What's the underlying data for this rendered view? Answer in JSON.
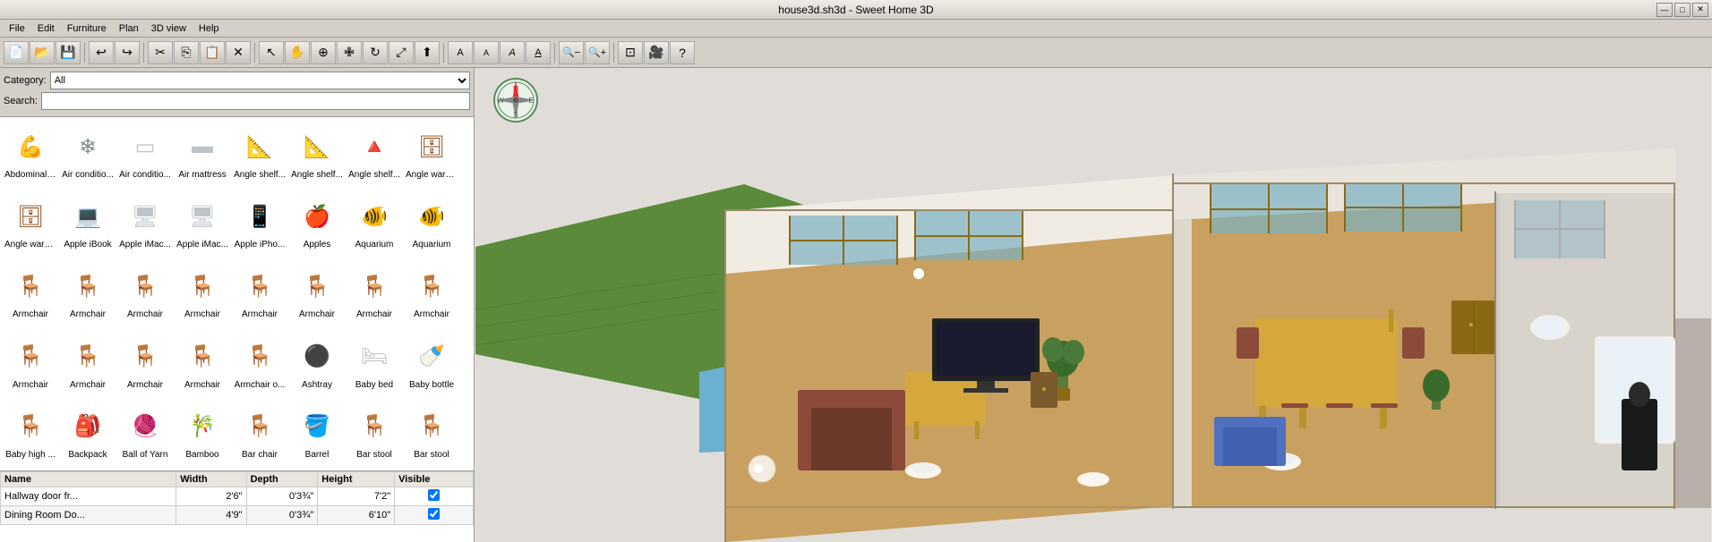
{
  "titlebar": {
    "title": "house3d.sh3d - Sweet Home 3D",
    "min_label": "—",
    "max_label": "□",
    "close_label": "✕"
  },
  "menu": {
    "items": [
      "File",
      "Edit",
      "Furniture",
      "Plan",
      "3D view",
      "Help"
    ]
  },
  "toolbar": {
    "buttons": [
      {
        "name": "new",
        "icon": "📄"
      },
      {
        "name": "open",
        "icon": "📂"
      },
      {
        "name": "save",
        "icon": "💾"
      },
      {
        "name": "sep1",
        "icon": ""
      },
      {
        "name": "undo",
        "icon": "↩"
      },
      {
        "name": "redo",
        "icon": "↪"
      },
      {
        "name": "sep2",
        "icon": ""
      },
      {
        "name": "cut",
        "icon": "✂"
      },
      {
        "name": "copy",
        "icon": "⎘"
      },
      {
        "name": "paste",
        "icon": "📋"
      },
      {
        "name": "delete",
        "icon": "🗑"
      },
      {
        "name": "sep3",
        "icon": ""
      },
      {
        "name": "select",
        "icon": "↖"
      },
      {
        "name": "pan",
        "icon": "✋"
      },
      {
        "name": "zoom-in-plan",
        "icon": "⊕"
      },
      {
        "name": "move",
        "icon": "⊕"
      },
      {
        "name": "rotate",
        "icon": "↻"
      },
      {
        "name": "resize",
        "icon": "⤢"
      },
      {
        "name": "elevate",
        "icon": "▲"
      },
      {
        "name": "sep4",
        "icon": ""
      },
      {
        "name": "text",
        "icon": "A"
      },
      {
        "name": "text2",
        "icon": "A"
      },
      {
        "name": "text3",
        "icon": "A"
      },
      {
        "name": "text4",
        "icon": "A"
      },
      {
        "name": "sep5",
        "icon": ""
      },
      {
        "name": "zoom-out",
        "icon": "🔍"
      },
      {
        "name": "zoom-in",
        "icon": "🔍"
      },
      {
        "name": "sep6",
        "icon": ""
      },
      {
        "name": "top-view",
        "icon": "⊡"
      },
      {
        "name": "camera",
        "icon": "🎥"
      },
      {
        "name": "help",
        "icon": "?"
      }
    ]
  },
  "left_panel": {
    "category_label": "Category:",
    "category_value": "All",
    "search_label": "Search:",
    "search_placeholder": "",
    "furniture": [
      {
        "name": "Abdominal ...",
        "icon": "💪",
        "color": "icon-red"
      },
      {
        "name": "Air conditio...",
        "icon": "❄",
        "color": "icon-gray"
      },
      {
        "name": "Air conditio...",
        "icon": "▭",
        "color": "icon-white"
      },
      {
        "name": "Air mattress",
        "icon": "▬",
        "color": "icon-white"
      },
      {
        "name": "Angle shelf...",
        "icon": "📐",
        "color": "icon-gray"
      },
      {
        "name": "Angle shelf...",
        "icon": "📐",
        "color": "icon-gray"
      },
      {
        "name": "Angle shelf...",
        "icon": "🔺",
        "color": "icon-gray"
      },
      {
        "name": "Angle ward...",
        "icon": "🗄",
        "color": "icon-brown"
      },
      {
        "name": "Angle ward...",
        "icon": "🗄",
        "color": "icon-brown"
      },
      {
        "name": "Apple iBook",
        "icon": "💻",
        "color": "icon-gray"
      },
      {
        "name": "Apple iMac...",
        "icon": "🖥",
        "color": "icon-white"
      },
      {
        "name": "Apple iMac...",
        "icon": "🖥",
        "color": "icon-white"
      },
      {
        "name": "Apple iPho...",
        "icon": "📱",
        "color": "icon-dark"
      },
      {
        "name": "Apples",
        "icon": "🍎",
        "color": "icon-red"
      },
      {
        "name": "Aquarium",
        "icon": "🐠",
        "color": "icon-blue"
      },
      {
        "name": "Aquarium",
        "icon": "🐠",
        "color": "icon-blue"
      },
      {
        "name": "Armchair",
        "icon": "🪑",
        "color": "icon-dark"
      },
      {
        "name": "Armchair",
        "icon": "🪑",
        "color": "icon-gray"
      },
      {
        "name": "Armchair",
        "icon": "🪑",
        "color": "icon-blue"
      },
      {
        "name": "Armchair",
        "icon": "🪑",
        "color": "icon-blue"
      },
      {
        "name": "Armchair",
        "icon": "🪑",
        "color": "icon-yellow"
      },
      {
        "name": "Armchair",
        "icon": "🪑",
        "color": "icon-brown"
      },
      {
        "name": "Armchair",
        "icon": "🪑",
        "color": "icon-gray"
      },
      {
        "name": "Armchair",
        "icon": "🪑",
        "color": "icon-dark"
      },
      {
        "name": "Armchair",
        "icon": "🪑",
        "color": "icon-white"
      },
      {
        "name": "Armchair",
        "icon": "🪑",
        "color": "icon-red"
      },
      {
        "name": "Armchair",
        "icon": "🪑",
        "color": "icon-gray"
      },
      {
        "name": "Armchair",
        "icon": "🪑",
        "color": "icon-green"
      },
      {
        "name": "Armchair o...",
        "icon": "🪑",
        "color": "icon-brown"
      },
      {
        "name": "Ashtray",
        "icon": "⚫",
        "color": "icon-gray"
      },
      {
        "name": "Baby bed",
        "icon": "🛏",
        "color": "icon-white"
      },
      {
        "name": "Baby bottle",
        "icon": "🍼",
        "color": "icon-blue"
      },
      {
        "name": "Baby high ...",
        "icon": "🪑",
        "color": "icon-green"
      },
      {
        "name": "Backpack",
        "icon": "🎒",
        "color": "icon-brown"
      },
      {
        "name": "Ball of Yarn",
        "icon": "🧶",
        "color": "icon-gray"
      },
      {
        "name": "Bamboo",
        "icon": "🎋",
        "color": "icon-green"
      },
      {
        "name": "Bar chair",
        "icon": "🪑",
        "color": "icon-brown"
      },
      {
        "name": "Barrel",
        "icon": "🪣",
        "color": "icon-brown"
      },
      {
        "name": "Bar stool",
        "icon": "🪑",
        "color": "icon-red"
      },
      {
        "name": "Bar stool",
        "icon": "🪑",
        "color": "icon-gray"
      }
    ]
  },
  "properties": {
    "columns": [
      "Name",
      "Width",
      "Depth",
      "Height",
      "Visible"
    ],
    "rows": [
      {
        "name": "Hallway door fr...",
        "width": "2'6\"",
        "depth": "0'3¾\"",
        "height": "7'2\"",
        "visible": true
      },
      {
        "name": "Dining Room Do...",
        "width": "4'9\"",
        "depth": "0'3¾\"",
        "height": "6'10\"",
        "visible": true
      }
    ]
  },
  "compass": {
    "symbol": "⊕"
  },
  "colors": {
    "background_3d": "#e8e5e0",
    "floor": "#c8a060",
    "wall": "#f0ece4",
    "grass": "#4a7a3a",
    "pool": "#6ab0d0",
    "accent": "#0078d7"
  }
}
